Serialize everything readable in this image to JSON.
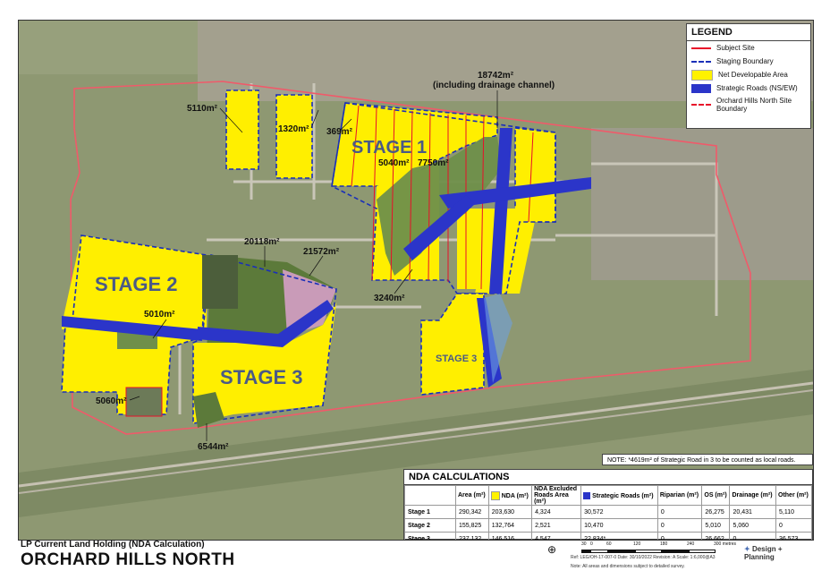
{
  "map": {
    "stages": [
      {
        "id": "stage-1",
        "label": "STAGE 1"
      },
      {
        "id": "stage-2",
        "label": "STAGE 2"
      },
      {
        "id": "stage-3",
        "label": "STAGE 3"
      },
      {
        "id": "stage-3-small",
        "label": "STAGE 3"
      }
    ],
    "area_labels": [
      {
        "id": "a5110",
        "text": "5110m²"
      },
      {
        "id": "a1320",
        "text": "1320m²"
      },
      {
        "id": "a369",
        "text": "369m²"
      },
      {
        "id": "a18742a",
        "text": "18742m²"
      },
      {
        "id": "a18742b",
        "text": "(including drainage channel)"
      },
      {
        "id": "a5040",
        "text": "5040m²"
      },
      {
        "id": "a7750",
        "text": "7750m²"
      },
      {
        "id": "a20118",
        "text": "20118m²"
      },
      {
        "id": "a21572",
        "text": "21572m²"
      },
      {
        "id": "a5010",
        "text": "5010m²"
      },
      {
        "id": "a3240",
        "text": "3240m²"
      },
      {
        "id": "a5060",
        "text": "5060m²"
      },
      {
        "id": "a6544",
        "text": "6544m²"
      }
    ]
  },
  "legend": {
    "title": "LEGEND",
    "items": [
      {
        "label": "Subject Site",
        "color": "#e8102a"
      },
      {
        "label": "Staging Boundary",
        "color": "#1a2fb8"
      },
      {
        "label": "Net Developable Area",
        "color": "#fff200"
      },
      {
        "label": "Strategic Roads (NS/EW)",
        "color": "#2b35c9"
      },
      {
        "label": "Orchard Hills North Site Boundary",
        "color": "#e8102a"
      }
    ]
  },
  "note": "NOTE: *4619m² of Strategic Road in 3 to be counted as local roads.",
  "nda": {
    "title": "NDA CALCULATIONS",
    "headers": [
      "",
      "Area (m²)",
      "NDA (m²)",
      "NDA Excluded Roads Area (m²)",
      "Strategic Roads (m²)",
      "Riparian (m²)",
      "OS (m²)",
      "Drainage (m²)",
      "Other (m²)"
    ],
    "rows": [
      {
        "label": "Stage 1",
        "values": [
          "290,342",
          "203,630",
          "4,324",
          "30,572",
          "0",
          "26,275",
          "20,431",
          "5,110"
        ]
      },
      {
        "label": "Stage 2",
        "values": [
          "155,825",
          "132,764",
          "2,521",
          "10,470",
          "0",
          "5,010",
          "5,060",
          "0"
        ]
      },
      {
        "label": "Stage 3",
        "values": [
          "237,132",
          "146,516",
          "4,547",
          "22,834*",
          "0",
          "26,662",
          "0",
          "36,573"
        ]
      }
    ]
  },
  "title_block": {
    "subtitle": "LP Current Land Holding (NDA Calculation)",
    "title": "ORCHARD HILLS NORTH",
    "scale_ticks": [
      "30",
      "0",
      "60",
      "120",
      "180",
      "240",
      "300 metres"
    ],
    "ref": "Ref: LEG/OH-17-007-0   Date: 30/10/2022   Revision: A   Scale: 1:6,000@A3",
    "footnote": "Note: All areas and dimensions subject to detailed survey.",
    "company": "Design + Planning"
  }
}
